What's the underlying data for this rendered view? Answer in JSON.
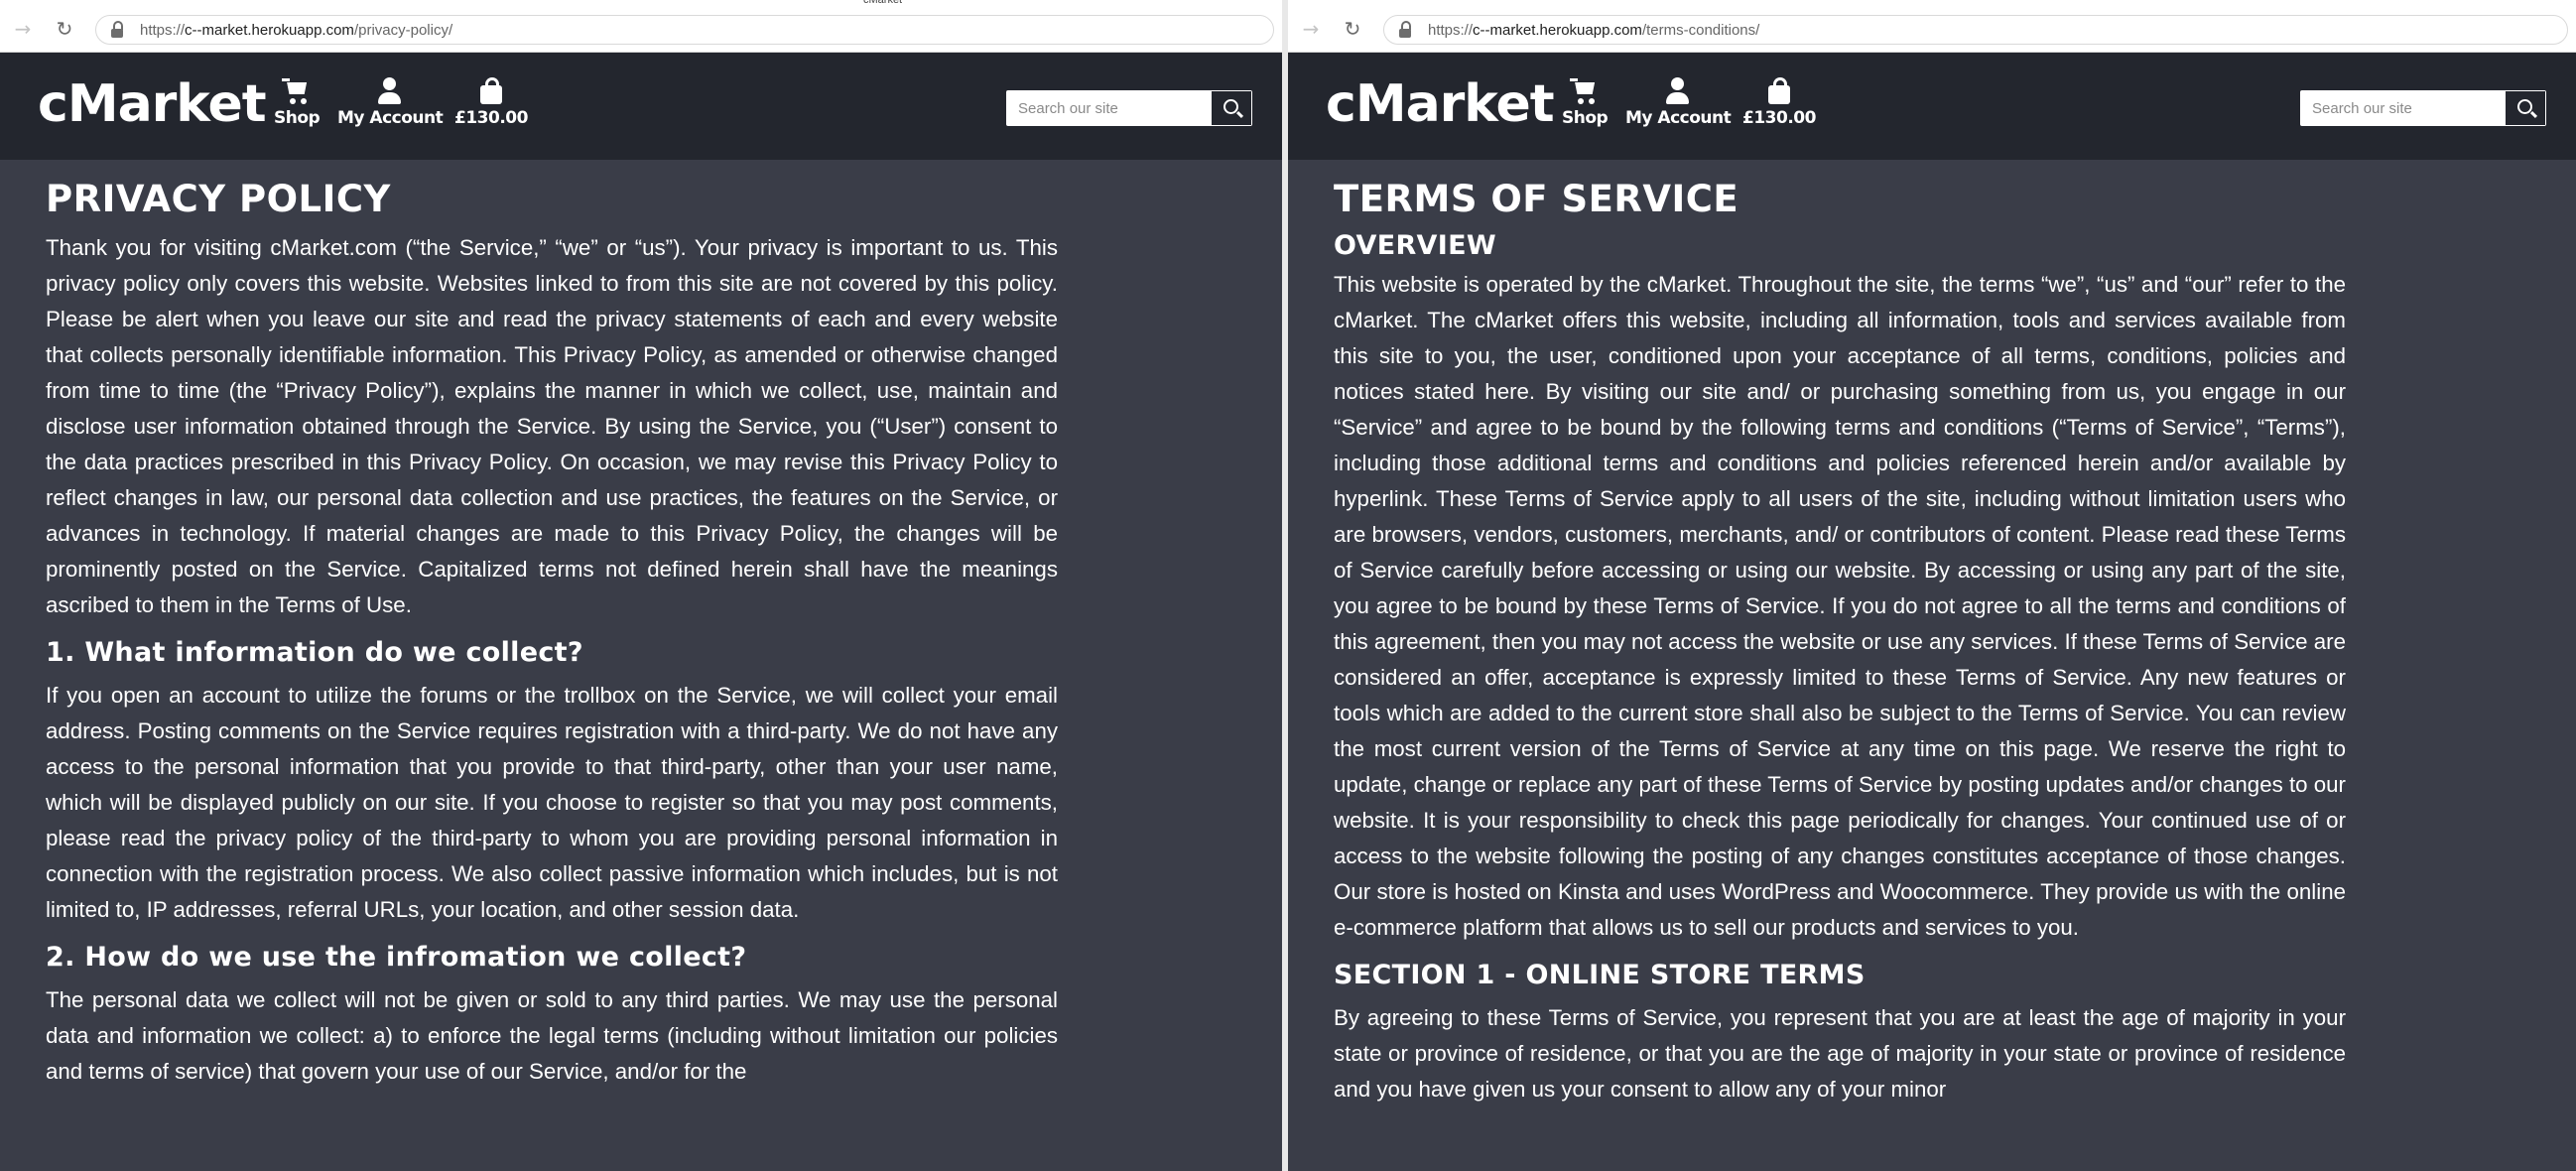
{
  "window_title": "cMarket",
  "left": {
    "url": {
      "proto": "https://",
      "host": "c--market.herokuapp.com",
      "path": "/privacy-policy/"
    },
    "header": {
      "logo": "cMarket",
      "nav": {
        "shop": "Shop",
        "account": "My Account",
        "cart": "£130.00"
      },
      "search_placeholder": "Search our site"
    },
    "title": "PRIVACY POLICY",
    "intro": "Thank you for visiting cMarket.com (“the Service,” “we” or “us”). Your privacy is important to us. This privacy policy only covers this website. Websites linked to from this site are not covered by this policy. Please be alert when you leave our site and read the privacy statements of each and every website that collects personally identifiable information. This Privacy Policy, as amended or otherwise changed from time to time (the “Privacy Policy”), explains the manner in which we collect, use, maintain and disclose user information obtained through the Service. By using the Service, you (“User”) consent to the data practices prescribed in this Privacy Policy. On occasion, we may revise this Privacy Policy to reflect changes in law, our personal data collection and use practices, the features on the Service, or advances in technology. If material changes are made to this Privacy Policy, the changes will be prominently posted on the Service. Capitalized terms not defined herein shall have the meanings ascribed to them in the Terms of Use.",
    "s1_heading": "1. What information do we collect?",
    "s1_body": "If you open an account to utilize the forums or the trollbox on the Service, we will collect your email address. Posting comments on the Service requires registration with a third-party. We do not have any access to the personal information that you provide to that third-party, other than your user name, which will be displayed publicly on our site. If you choose to register so that you may post comments, please read the privacy policy of the third-party to whom you are providing personal information in connection with the registration process. We also collect passive information which includes, but is not limited to, IP addresses, referral URLs, your location, and other session data.",
    "s2_heading": "2. How do we use the infromation we collect?",
    "s2_body": "The personal data we collect will not be given or sold to any third parties. We may use the personal data and information we collect: a) to enforce the legal terms (including without limitation our policies and terms of service) that govern your use of our Service, and/or for the"
  },
  "right": {
    "url": {
      "proto": "https://",
      "host": "c--market.herokuapp.com",
      "path": "/terms-conditions/"
    },
    "header": {
      "logo": "cMarket",
      "nav": {
        "shop": "Shop",
        "account": "My Account",
        "cart": "£130.00"
      },
      "search_placeholder": "Search our site"
    },
    "title": "TERMS OF SERVICE",
    "overview_heading": "OVERVIEW",
    "overview_body": "This website is operated by the cMarket. Throughout the site, the terms “we”, “us” and “our” refer to the cMarket. The cMarket offers this website, including all information, tools and services available from this site to you, the user, conditioned upon your acceptance of all terms, conditions, policies and notices stated here. By visiting our site and/ or purchasing something from us, you engage in our “Service” and agree to be bound by the following terms and conditions (“Terms of Service”, “Terms”), including those additional terms and conditions and policies referenced herein and/or available by hyperlink. These Terms of Service apply to all users of the site, including without limitation users who are browsers, vendors, customers, merchants, and/ or contributors of content. Please read these Terms of Service carefully before accessing or using our website. By accessing or using any part of the site, you agree to be bound by these Terms of Service. If you do not agree to all the terms and conditions of this agreement, then you may not access the website or use any services. If these Terms of Service are considered an offer, acceptance is expressly limited to these Terms of Service. Any new features or tools which are added to the current store shall also be subject to the Terms of Service. You can review the most current version of the Terms of Service at any time on this page. We reserve the right to update, change or replace any part of these Terms of Service by posting updates and/or changes to our website. It is your responsibility to check this page periodically for changes. Your continued use of or access to the website following the posting of any changes constitutes acceptance of those changes. Our store is hosted on Kinsta and uses WordPress and Woocommerce. They provide us with the online e-commerce platform that allows us to sell our products and services to you.",
    "s1_heading": "SECTION 1 - ONLINE STORE TERMS",
    "s1_body": "By agreeing to these Terms of Service, you represent that you are at least the age of majority in your state or province of residence, or that you are the age of majority in your state or province of residence and you have given us your consent to allow any of your minor"
  }
}
